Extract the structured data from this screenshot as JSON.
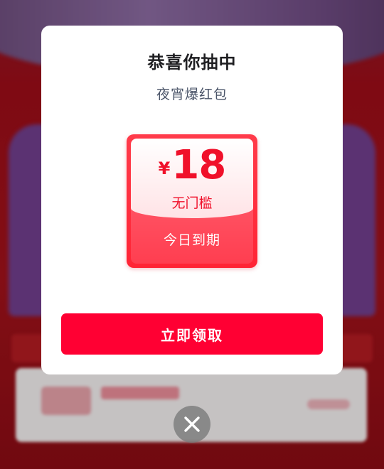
{
  "modal": {
    "title": "恭喜你抽中",
    "subtitle": "夜宵爆红包"
  },
  "coupon": {
    "currency": "¥",
    "value": "18",
    "condition": "无门槛",
    "expire": "今日到期"
  },
  "actions": {
    "claim_label": "立即领取"
  },
  "icons": {
    "close": "close-icon"
  },
  "colors": {
    "accent": "#ff0033",
    "coupon_red": "#f0102a",
    "title": "#1f1f22",
    "subtitle": "#4a5468"
  }
}
